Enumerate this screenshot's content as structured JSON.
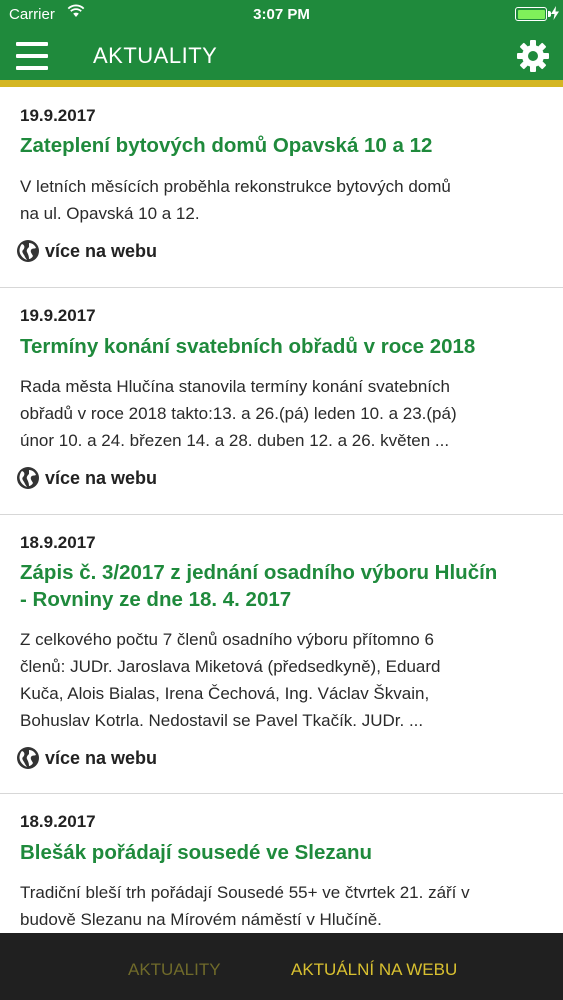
{
  "status_bar": {
    "carrier": "Carrier",
    "time": "3:07 PM"
  },
  "nav": {
    "title": "AKTUALITY"
  },
  "articles": [
    {
      "date": "19.9.2017",
      "title": "Zateplení bytových domů Opavská 10 a 12",
      "summary": [
        "V letních měsících proběhla rekonstrukce bytových domů",
        "na ul. Opavská 10 a 12."
      ],
      "link": "více na webu"
    },
    {
      "date": "19.9.2017",
      "title": "Termíny konání svatebních obřadů v roce 2018",
      "summary": [
        "Rada města Hlučína stanovila termíny konání svatebních",
        "obřadů v roce 2018 takto:13. a 26.(pá) leden 10. a 23.(pá)",
        "únor 10. a 24. březen  14. a 28. duben  12. a 26. květen  ..."
      ],
      "link": "více na webu"
    },
    {
      "date": "18.9.2017",
      "title": [
        "Zápis č. 3/2017 z jednání osadního výboru Hlučín",
        "- Rovniny ze dne 18. 4. 2017"
      ],
      "summary": [
        "Z celkového počtu 7 členů osadního výboru přítomno 6",
        "členů: JUDr. Jaroslava Miketová (předsedkyně), Eduard",
        "Kuča, Alois Bialas, Irena Čechová, Ing. Václav Škvain,",
        "Bohuslav Kotrla. Nedostavil se Pavel Tkačík. JUDr. ..."
      ],
      "link": "více na webu"
    },
    {
      "date": "18.9.2017",
      "title": "Blešák pořádají sousedé ve Slezanu",
      "summary": [
        "Tradiční bleší trh pořádají Sousedé 55+ ve čtvrtek 21. září v",
        "budově Slezanu na Mírovém náměstí v Hlučíně."
      ],
      "link": ""
    }
  ],
  "tab_bar": {
    "tab1": "AKTUALITY",
    "tab2": "AKTUÁLNÍ NA WEBU"
  }
}
